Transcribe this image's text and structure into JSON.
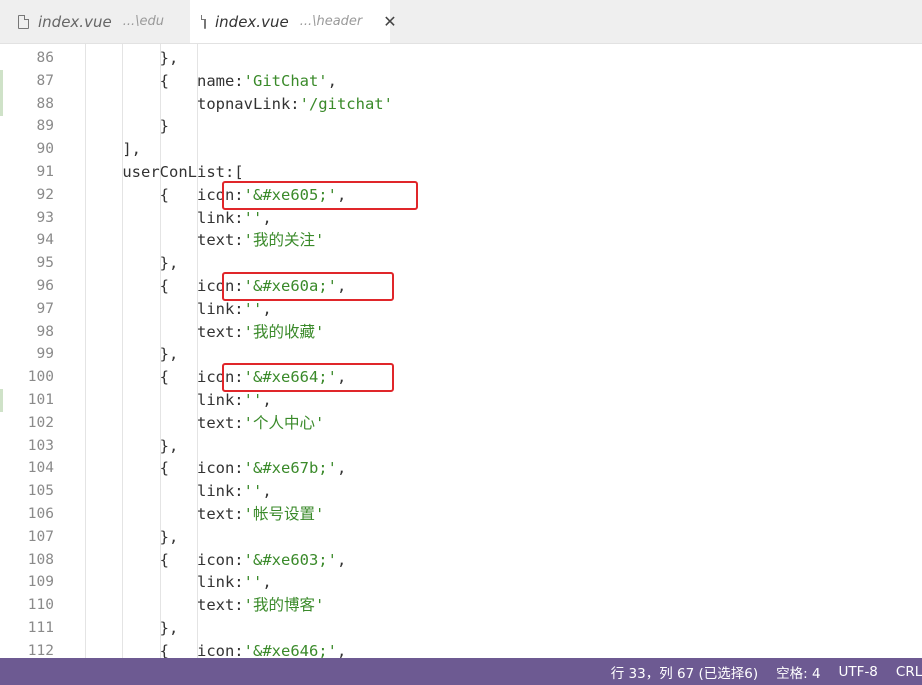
{
  "tabs": [
    {
      "name": "index.vue",
      "path": "...\\edu",
      "active": false
    },
    {
      "name": "index.vue",
      "path": "...\\header",
      "active": true
    }
  ],
  "lines": [
    {
      "num": "86",
      "indent": "        ",
      "code": [
        {
          "t": "},"
        }
      ]
    },
    {
      "num": "87",
      "indent": "        ",
      "code": [
        {
          "t": "{   name:"
        },
        {
          "t": "'GitChat'",
          "s": 1
        },
        {
          "t": ","
        }
      ]
    },
    {
      "num": "88",
      "indent": "        ",
      "code": [
        {
          "t": "    topnavLink:"
        },
        {
          "t": "'/gitchat'",
          "s": 1
        }
      ]
    },
    {
      "num": "89",
      "indent": "        ",
      "code": [
        {
          "t": "}"
        }
      ]
    },
    {
      "num": "90",
      "indent": "    ",
      "code": [
        {
          "t": "],"
        }
      ]
    },
    {
      "num": "91",
      "indent": "    ",
      "code": [
        {
          "t": "userConList:["
        }
      ]
    },
    {
      "num": "92",
      "indent": "        ",
      "code": [
        {
          "t": "{   icon:"
        },
        {
          "t": "'&#xe605;'",
          "s": 1
        },
        {
          "t": ","
        }
      ]
    },
    {
      "num": "93",
      "indent": "        ",
      "code": [
        {
          "t": "    link:"
        },
        {
          "t": "''",
          "s": 1
        },
        {
          "t": ","
        }
      ]
    },
    {
      "num": "94",
      "indent": "        ",
      "code": [
        {
          "t": "    text:"
        },
        {
          "t": "'我的关注'",
          "s": 1
        }
      ]
    },
    {
      "num": "95",
      "indent": "        ",
      "code": [
        {
          "t": "},"
        }
      ]
    },
    {
      "num": "96",
      "indent": "        ",
      "code": [
        {
          "t": "{   icon:"
        },
        {
          "t": "'&#xe60a;'",
          "s": 1
        },
        {
          "t": ","
        }
      ]
    },
    {
      "num": "97",
      "indent": "        ",
      "code": [
        {
          "t": "    link:"
        },
        {
          "t": "''",
          "s": 1
        },
        {
          "t": ","
        }
      ]
    },
    {
      "num": "98",
      "indent": "        ",
      "code": [
        {
          "t": "    text:"
        },
        {
          "t": "'我的收藏'",
          "s": 1
        }
      ]
    },
    {
      "num": "99",
      "indent": "        ",
      "code": [
        {
          "t": "},"
        }
      ]
    },
    {
      "num": "100",
      "indent": "        ",
      "code": [
        {
          "t": "{   icon:"
        },
        {
          "t": "'&#xe664;'",
          "s": 1
        },
        {
          "t": ","
        }
      ]
    },
    {
      "num": "101",
      "indent": "        ",
      "code": [
        {
          "t": "    link:"
        },
        {
          "t": "''",
          "s": 1
        },
        {
          "t": ","
        }
      ]
    },
    {
      "num": "102",
      "indent": "        ",
      "code": [
        {
          "t": "    text:"
        },
        {
          "t": "'个人中心'",
          "s": 1
        }
      ]
    },
    {
      "num": "103",
      "indent": "        ",
      "code": [
        {
          "t": "},"
        }
      ]
    },
    {
      "num": "104",
      "indent": "        ",
      "code": [
        {
          "t": "{   icon:"
        },
        {
          "t": "'&#xe67b;'",
          "s": 1
        },
        {
          "t": ","
        }
      ]
    },
    {
      "num": "105",
      "indent": "        ",
      "code": [
        {
          "t": "    link:"
        },
        {
          "t": "''",
          "s": 1
        },
        {
          "t": ","
        }
      ]
    },
    {
      "num": "106",
      "indent": "        ",
      "code": [
        {
          "t": "    text:"
        },
        {
          "t": "'帐号设置'",
          "s": 1
        }
      ]
    },
    {
      "num": "107",
      "indent": "        ",
      "code": [
        {
          "t": "},"
        }
      ]
    },
    {
      "num": "108",
      "indent": "        ",
      "code": [
        {
          "t": "{   icon:"
        },
        {
          "t": "'&#xe603;'",
          "s": 1
        },
        {
          "t": ","
        }
      ]
    },
    {
      "num": "109",
      "indent": "        ",
      "code": [
        {
          "t": "    link:"
        },
        {
          "t": "''",
          "s": 1
        },
        {
          "t": ","
        }
      ]
    },
    {
      "num": "110",
      "indent": "        ",
      "code": [
        {
          "t": "    text:"
        },
        {
          "t": "'我的博客'",
          "s": 1
        }
      ]
    },
    {
      "num": "111",
      "indent": "        ",
      "code": [
        {
          "t": "},"
        }
      ]
    },
    {
      "num": "112",
      "indent": "        ",
      "code": [
        {
          "t": "{   icon:"
        },
        {
          "t": "'&#xe646;'",
          "s": 1
        },
        {
          "t": ","
        }
      ]
    }
  ],
  "changed_lines": [
    "87",
    "88",
    "101"
  ],
  "highlighted_lines": [
    "92",
    "96",
    "100"
  ],
  "status": {
    "position": "行 33，列 67 (已选择6)",
    "indent": "空格: 4",
    "encoding": "UTF-8",
    "eol": "CRLF"
  },
  "colors": {
    "status_bar": "#6d5a92",
    "string": "#3a8a2a",
    "highlight_box": "#e0262a"
  }
}
